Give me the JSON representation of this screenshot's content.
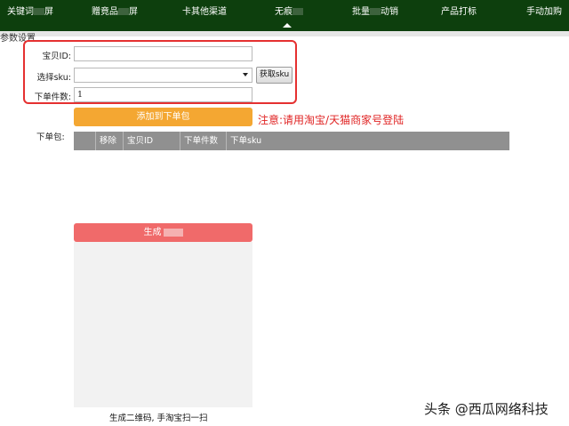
{
  "nav": {
    "items": [
      {
        "label_a": "关键词",
        "label_b": "屏"
      },
      {
        "label_a": "赠竟品",
        "label_b": "屏"
      },
      {
        "label_a": "卡其他渠道",
        "label_b": ""
      },
      {
        "label_a": "无痕",
        "label_b": ""
      },
      {
        "label_a": "批量",
        "label_b": "动销"
      },
      {
        "label_a": "产品打标",
        "label_b": ""
      },
      {
        "label_a": "手动加购",
        "label_b": ""
      }
    ]
  },
  "section_title": "参数设置",
  "form": {
    "item_id_label": "宝贝ID:",
    "item_id_value": "",
    "sku_label": "选择sku:",
    "sku_value": "",
    "fetch_sku_label": "获取sku",
    "quantity_label": "下单件数:",
    "quantity_value": "1"
  },
  "add_to_package_label": "添加到下单包",
  "notice_text": "注意:请用淘宝/天猫商家号登陆",
  "package": {
    "label": "下单包:",
    "columns": [
      "移除",
      "宝贝ID",
      "下单件数",
      "下单sku"
    ]
  },
  "generate_label": "生成",
  "qr_caption": "生成二维码, 手淘宝扫一扫",
  "watermark": "头条 @西瓜网络科技",
  "colors": {
    "nav_bg": "#0d3f0d",
    "add_button": "#f4a732",
    "generate_button": "#f06a6a",
    "notice": "#e02424",
    "highlight_box": "#e53030",
    "table_header": "#909090"
  }
}
